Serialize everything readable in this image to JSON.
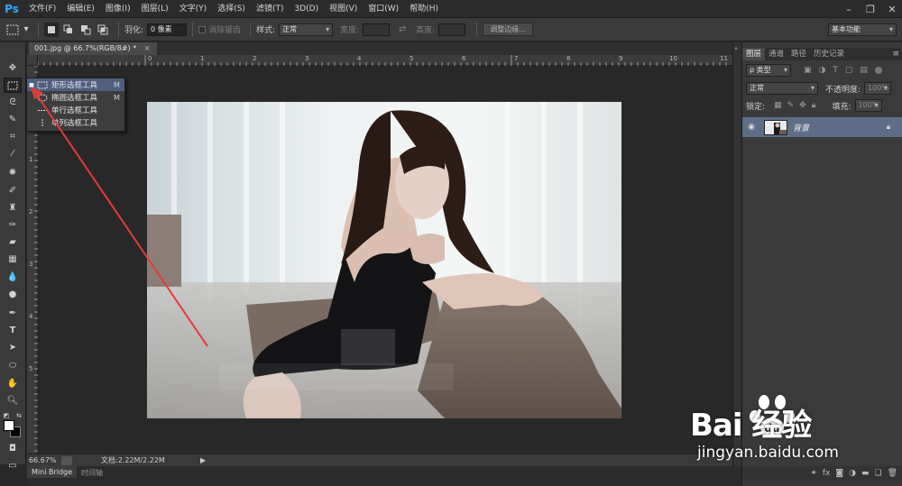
{
  "app": {
    "logo": "Ps"
  },
  "menu": [
    "文件(F)",
    "编辑(E)",
    "图像(I)",
    "图层(L)",
    "文字(Y)",
    "选择(S)",
    "滤镜(T)",
    "3D(D)",
    "视图(V)",
    "窗口(W)",
    "帮助(H)"
  ],
  "options": {
    "feather_label": "羽化:",
    "feather_value": "0 像素",
    "antialias_label": "消除锯齿",
    "style_label": "样式:",
    "style_value": "正常",
    "width_label": "宽度:",
    "height_label": "高度:",
    "refine_button": "调整边缘...",
    "workspace": "基本功能"
  },
  "document": {
    "tab_title": "001.jpg @ 66.7%(RGB/8#) *"
  },
  "rulers": {
    "h": [
      "0",
      "1",
      "2",
      "3",
      "4",
      "5",
      "6",
      "7",
      "8",
      "9",
      "10",
      "11"
    ],
    "v": [
      "1",
      "2",
      "3",
      "4",
      "5"
    ]
  },
  "flyout": {
    "items": [
      {
        "label": "矩形选框工具",
        "key": "M",
        "icon": "rect-marquee-icon",
        "selected": true
      },
      {
        "label": "椭圆选框工具",
        "key": "M",
        "icon": "ellipse-marquee-icon",
        "selected": false
      },
      {
        "label": "单行选框工具",
        "key": "",
        "icon": "single-row-marquee-icon",
        "selected": false
      },
      {
        "label": "单列选框工具",
        "key": "",
        "icon": "single-column-marquee-icon",
        "selected": false
      }
    ]
  },
  "status": {
    "zoom": "66.67%",
    "doc": "文档:2.22M/2.22M"
  },
  "bottom_tabs": [
    "Mini Bridge",
    "时间轴"
  ],
  "panels": {
    "tabs": [
      "图层",
      "通道",
      "路径",
      "历史记录"
    ],
    "filter_label": "ρ 类型",
    "blend_mode": "正常",
    "opacity_label": "不透明度:",
    "opacity_value": "100%",
    "lock_label": "锁定:",
    "fill_label": "填充:",
    "fill_value": "100%",
    "layer_name": "背景"
  },
  "watermark": {
    "logo": "Bai 经验",
    "url": "jingyan.baidu.com"
  },
  "colors": {
    "accent_arrow": "#e23b3b",
    "selection": "#4f5f80",
    "layer_selected": "#5e6e86"
  }
}
